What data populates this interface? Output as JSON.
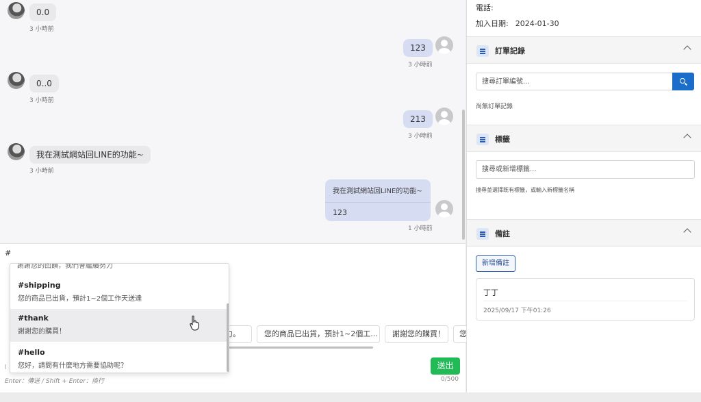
{
  "chat": {
    "messages": [
      {
        "side": "in",
        "text": "0.0",
        "time": "3 小時前"
      },
      {
        "side": "out",
        "text": "123",
        "time": "3 小時前"
      },
      {
        "side": "in",
        "text": "0..0",
        "time": "3 小時前"
      },
      {
        "side": "out",
        "text": "213",
        "time": "3 小時前"
      },
      {
        "side": "in",
        "text": "我在測試網站回LINE的功能~",
        "time": "3 小時前"
      },
      {
        "side": "out",
        "text": "我在測試網站回LINE的功能~",
        "text2": "123",
        "time": "1 小時前"
      }
    ]
  },
  "composer": {
    "input_value": "#",
    "quick_replies": [
      "力。",
      "您的商品已出貨，預計1~2個工...",
      "謝謝您的購買！",
      "您"
    ],
    "send_label": "送出",
    "hint": "Enter：傳送 / Shift + Enter：換行",
    "counter": "0/500"
  },
  "suggestions": {
    "partial_text": "謝謝您的回饋，我們會繼續努力",
    "items": [
      {
        "key": "#shipping",
        "desc": "您的商品已出貨，預計1~2個工作天送達",
        "highlighted": false
      },
      {
        "key": "#thank",
        "desc": "謝謝您的購買！",
        "highlighted": true
      },
      {
        "key": "#hello",
        "desc": "您好，請問有什麼地方需要協助呢？",
        "highlighted": false
      }
    ]
  },
  "panel": {
    "phone_label": "電話:",
    "phone_value": "",
    "join_label": "加入日期:",
    "join_value": "2024-01-30",
    "orders": {
      "title": "訂單記錄",
      "search_placeholder": "搜尋訂單編號...",
      "empty": "尚無訂單記錄"
    },
    "tags": {
      "title": "標籤",
      "placeholder": "搜尋或新增標籤...",
      "help": "搜尋並選擇既有標籤，或輸入新標籤名稱"
    },
    "notes": {
      "title": "備註",
      "add_label": "新增備註",
      "items": [
        {
          "text": "丁丁",
          "date": "2025/09/17 下午01:26"
        }
      ]
    }
  },
  "colors": {
    "accent": "#1a6dc9",
    "send": "#22b957",
    "bubble_out": "#d6dcf2",
    "bubble_in": "#e9e9ec"
  },
  "icons": [
    "avatar",
    "user-placeholder-icon",
    "list-icon",
    "chevron-up-icon",
    "search-icon",
    "hand-cursor-icon"
  ]
}
